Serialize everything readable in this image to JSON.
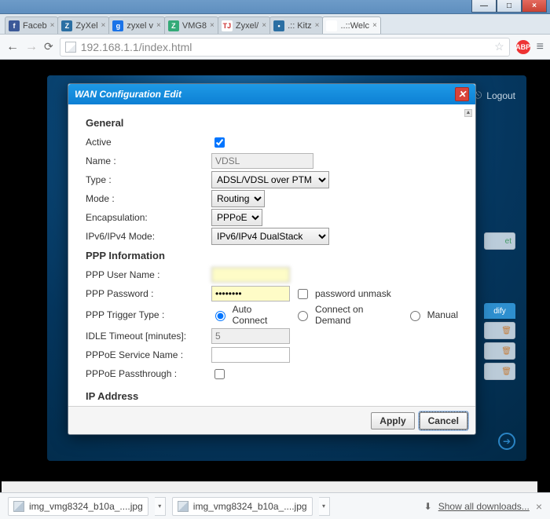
{
  "window": {
    "min_icon": "—",
    "max_icon": "□",
    "close_icon": "×"
  },
  "tabs": [
    {
      "label": "Faceb",
      "fav_bg": "#3b5998",
      "fav_txt": "f"
    },
    {
      "label": "ZyXel",
      "fav_bg": "#2b6fa3",
      "fav_txt": "Z"
    },
    {
      "label": "zyxel v",
      "fav_bg": "#1a73e8",
      "fav_txt": "g"
    },
    {
      "label": "VMG8",
      "fav_bg": "#3a7",
      "fav_txt": "Z"
    },
    {
      "label": "Zyxel/",
      "fav_bg": "#fff",
      "fav_txt": "TJ",
      "fav_color": "#c33"
    },
    {
      "label": ".:: Kitz",
      "fav_bg": "#2b6fa3",
      "fav_txt": "•"
    },
    {
      "label": "..::Welc",
      "fav_bg": "#fff",
      "fav_txt": "",
      "active": true
    }
  ],
  "toolbar": {
    "url": "192.168.1.1/index.html",
    "ext_badge": "ABP"
  },
  "background": {
    "logout_label": "Logout",
    "right_head": "dify",
    "right_cell": "et"
  },
  "modal": {
    "title": "WAN Configuration Edit",
    "sections": {
      "general_h": "General",
      "ppp_h": "PPP Information",
      "ip_h": "IP Address"
    },
    "general": {
      "active_label": "Active",
      "active_checked": true,
      "name_label": "Name :",
      "name_value": "VDSL",
      "type_label": "Type :",
      "type_value": "ADSL/VDSL over PTM",
      "mode_label": "Mode :",
      "mode_value": "Routing",
      "encap_label": "Encapsulation:",
      "encap_value": "PPPoE",
      "ipmode_label": "IPv6/IPv4 Mode:",
      "ipmode_value": "IPv6/IPv4 DualStack"
    },
    "ppp": {
      "user_label": "PPP User Name :",
      "user_value": "",
      "pass_label": "PPP Password :",
      "pass_value": "••••••••",
      "unmask_label": "password unmask",
      "trigger_label": "PPP Trigger Type :",
      "trigger_options": {
        "auto": "Auto Connect",
        "demand": "Connect on Demand",
        "manual": "Manual"
      },
      "trigger_selected": "auto",
      "idle_label": "IDLE Timeout [minutes]:",
      "idle_value": "5",
      "svc_label": "PPPoE Service Name :",
      "svc_value": "",
      "pass_through_label": "PPPoE Passthrough :"
    },
    "buttons": {
      "apply": "Apply",
      "cancel": "Cancel"
    }
  },
  "downloads": {
    "item1": "img_vmg8324_b10a_....jpg",
    "item2": "img_vmg8324_b10a_....jpg",
    "show_all": "Show all downloads..."
  }
}
